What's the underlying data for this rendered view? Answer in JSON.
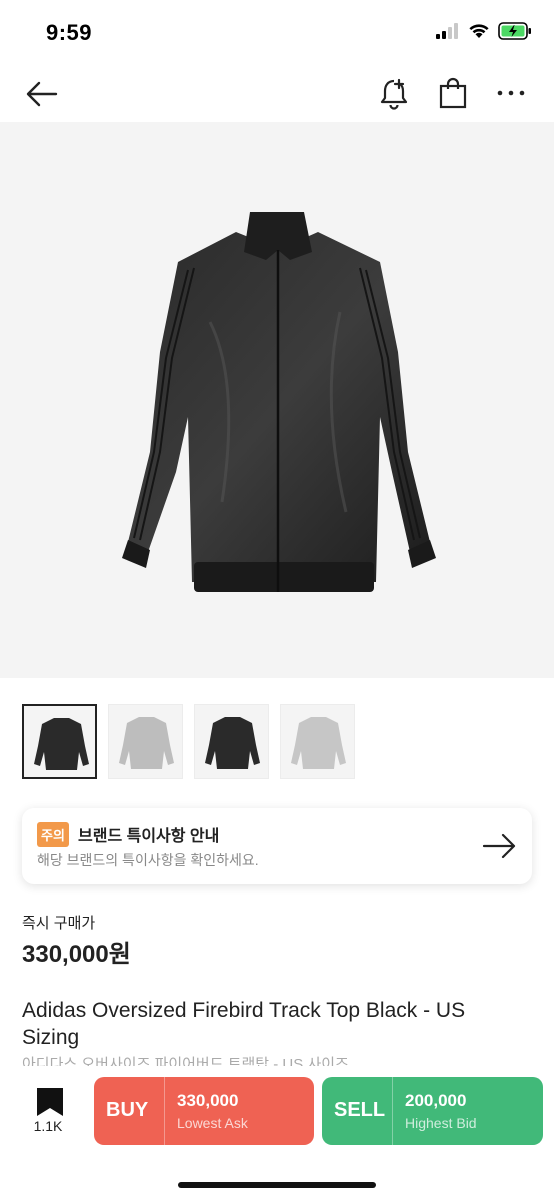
{
  "status": {
    "time": "9:59",
    "icons": [
      "signal-icon",
      "wifi-icon",
      "battery-charging-icon"
    ]
  },
  "nav": {
    "icons": [
      "back-arrow-icon",
      "bell-plus-icon",
      "shopping-bag-icon",
      "more-icon"
    ]
  },
  "gallery": {
    "thumbnail_count": 4,
    "selected_index": 0,
    "thumbnails": [
      "black",
      "silver",
      "black",
      "silver"
    ]
  },
  "notice": {
    "badge": "주의",
    "title": "브랜드 특이사항 안내",
    "description": "해당 브랜드의 특이사항을 확인하세요."
  },
  "price": {
    "label": "즉시 구매가",
    "value": "330,000원"
  },
  "product": {
    "name": "Adidas Oversized Firebird Track Top Black - US Sizing",
    "name_kr": "아디다스 오버사이즈 파이어버드 트랙탑 - US 사이즈"
  },
  "bottom": {
    "wish_count": "1.1K",
    "buy": {
      "label": "BUY",
      "price": "330,000",
      "sub": "Lowest Ask"
    },
    "sell": {
      "label": "SELL",
      "price": "200,000",
      "sub": "Highest Bid"
    }
  },
  "colors": {
    "buy": "#ef6253",
    "sell": "#41b979",
    "notice_badge": "#f2994a"
  }
}
